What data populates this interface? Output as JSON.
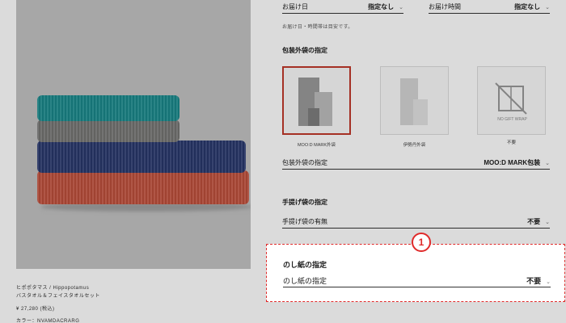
{
  "product": {
    "caption_line1": "ヒポポタマス / Hippopotamus",
    "caption_line2": "バスタオル＆フェイスタオルセット",
    "price": "¥ 27,280 (税込)",
    "color": "カラー：NVAMDACRARG"
  },
  "delivery": {
    "date_label": "お届け日",
    "date_value": "指定なし",
    "time_label": "お届け時間",
    "time_value": "指定なし",
    "note": "お届け日・時間帯は目安です。"
  },
  "gift_wrap": {
    "title": "包装外袋の指定",
    "options": [
      {
        "caption": "MOO:D MARK外袋",
        "selected": true
      },
      {
        "caption": "伊勢丹外袋",
        "selected": false
      },
      {
        "caption": "不要",
        "selected": false,
        "icon_text": "NO GIFT WRAP"
      }
    ],
    "select_label": "包装外袋の指定",
    "select_value": "MOO:D MARK包装"
  },
  "shopping_bag": {
    "title": "手提げ袋の指定",
    "select_label": "手提げ袋の有無",
    "select_value": "不要"
  },
  "noshi": {
    "title": "のし紙の指定",
    "select_label": "のし紙の指定",
    "select_value": "不要"
  },
  "badge": {
    "number": "1"
  },
  "colors": {
    "accent_red": "#e02a2a",
    "selected_border": "#c0392b",
    "overlay": "rgba(0,0,0,0.14)"
  }
}
